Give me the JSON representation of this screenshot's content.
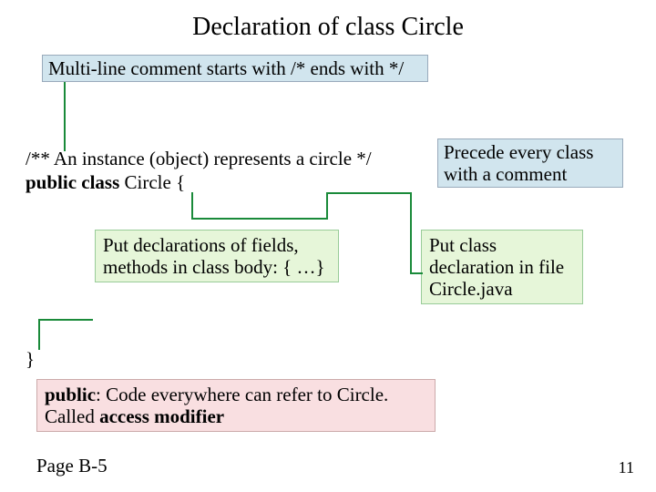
{
  "title": "Declaration of class Circle",
  "boxes": {
    "multiline": "Multi-line comment starts with /* ends with */",
    "precede": "Precede every class with a comment",
    "body": "Put declarations of fields, methods in class body: { …}",
    "file": "Put class declaration in file Circle.java",
    "public_html": "<b>public</b>: Code everywhere can refer to Circle. Called <b>access modifier</b>"
  },
  "code": {
    "c1": "/** An instance (object) represents a circle */",
    "c2_html": "<b>public class</b> Circle {",
    "c3": "}"
  },
  "footer": {
    "pageref": "Page B-5",
    "pagenum": "11"
  }
}
